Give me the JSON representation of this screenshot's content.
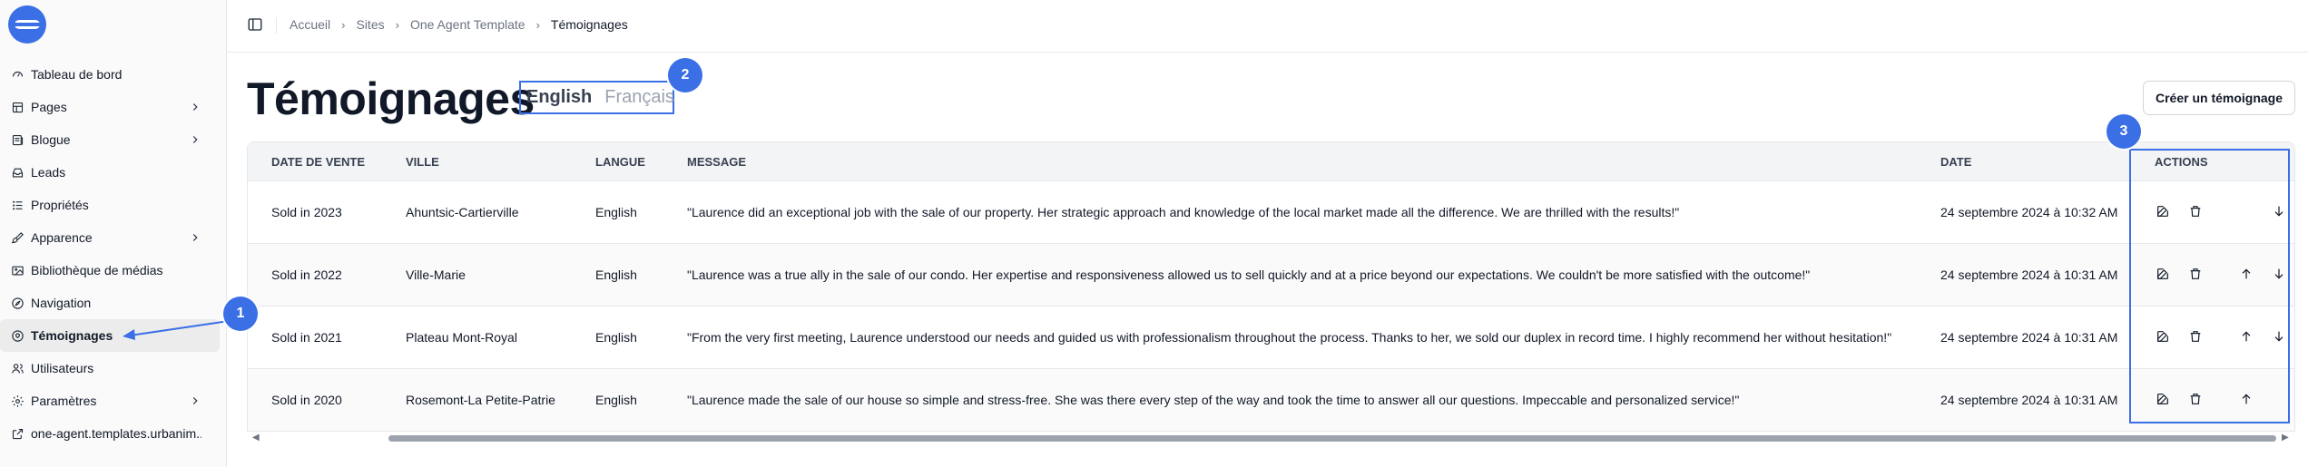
{
  "sidebar": {
    "items": [
      {
        "label": "Tableau de bord",
        "icon": "gauge-icon",
        "chevron": false
      },
      {
        "label": "Pages",
        "icon": "pages-icon",
        "chevron": true
      },
      {
        "label": "Blogue",
        "icon": "blog-icon",
        "chevron": true
      },
      {
        "label": "Leads",
        "icon": "leads-icon",
        "chevron": false
      },
      {
        "label": "Propriétés",
        "icon": "list-icon",
        "chevron": false
      },
      {
        "label": "Apparence",
        "icon": "brush-icon",
        "chevron": true
      },
      {
        "label": "Bibliothèque de médias",
        "icon": "media-icon",
        "chevron": false
      },
      {
        "label": "Navigation",
        "icon": "navigation-icon",
        "chevron": false
      },
      {
        "label": "Témoignages",
        "icon": "testimonials-icon",
        "chevron": false,
        "active": true
      },
      {
        "label": "Utilisateurs",
        "icon": "users-icon",
        "chevron": false
      },
      {
        "label": "Paramètres",
        "icon": "gear-icon",
        "chevron": true
      },
      {
        "label": "one-agent.templates.urbanim...",
        "icon": "external-link-icon",
        "chevron": false
      }
    ]
  },
  "breadcrumb": [
    "Accueil",
    "Sites",
    "One Agent Template",
    "Témoignages"
  ],
  "header": {
    "title": "Témoignages",
    "languages": [
      "English",
      "Français"
    ],
    "active_language": "English",
    "create_button": "Créer un témoignage"
  },
  "markers": [
    "1",
    "2",
    "3"
  ],
  "table": {
    "columns": [
      "DATE DE VENTE",
      "VILLE",
      "LANGUE",
      "MESSAGE",
      "DATE",
      "ACTIONS"
    ],
    "rows": [
      {
        "sale": "Sold in 2023",
        "city": "Ahuntsic-Cartierville",
        "lang": "English",
        "message": "\"Laurence did an exceptional job with the sale of our property. Her strategic approach and knowledge of the local market made all the difference. We are thrilled with the results!\"",
        "date": "24 septembre 2024 à 10:32 AM",
        "up": false,
        "down": true
      },
      {
        "sale": "Sold in 2022",
        "city": "Ville-Marie",
        "lang": "English",
        "message": "\"Laurence was a true ally in the sale of our condo. Her expertise and responsiveness allowed us to sell quickly and at a price beyond our expectations. We couldn't be more satisfied with the outcome!\"",
        "date": "24 septembre 2024 à 10:31 AM",
        "up": true,
        "down": true
      },
      {
        "sale": "Sold in 2021",
        "city": "Plateau Mont-Royal",
        "lang": "English",
        "message": "\"From the very first meeting, Laurence understood our needs and guided us with professionalism throughout the process. Thanks to her, we sold our duplex in record time. I highly recommend her without hesitation!\"",
        "date": "24 septembre 2024 à 10:31 AM",
        "up": true,
        "down": true
      },
      {
        "sale": "Sold in 2020",
        "city": "Rosemont-La Petite-Patrie",
        "lang": "English",
        "message": "\"Laurence made the sale of our house so simple and stress-free. She was there every step of the way and took the time to answer all our questions. Impeccable and personalized service!\"",
        "date": "24 septembre 2024 à 10:31 AM",
        "up": true,
        "down": false
      }
    ]
  },
  "colors": {
    "accent": "#3b6fe6"
  }
}
